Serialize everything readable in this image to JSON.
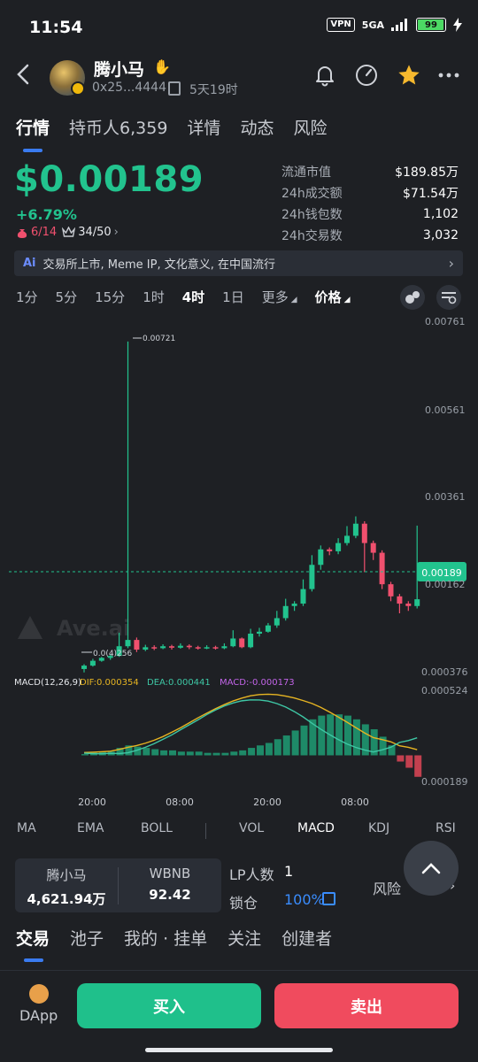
{
  "status_bar": {
    "time": "11:54",
    "vpn": "VPN",
    "network": "5GA",
    "battery": "99",
    "battery_level": 0.99
  },
  "header": {
    "token_name": "腾小马",
    "address": "0x25...4444",
    "age": "5天19时"
  },
  "tabs": [
    "行情",
    "持币人6,359",
    "详情",
    "动态",
    "风险"
  ],
  "price": {
    "value": "$0.00189",
    "change": "+6.79%",
    "badge_left": "6/14",
    "badge_right": "34/50"
  },
  "stats": [
    {
      "label": "流通市值",
      "value": "$189.85万"
    },
    {
      "label": "24h成交额",
      "value": "$71.54万"
    },
    {
      "label": "24h钱包数",
      "value": "1,102"
    },
    {
      "label": "24h交易数",
      "value": "3,032"
    }
  ],
  "ai_banner": {
    "icon": "Ai",
    "text": "交易所上市, Meme IP, 文化意义, 在中国流行"
  },
  "timeframes": [
    "1分",
    "5分",
    "15分",
    "1时",
    "4时",
    "1日",
    "更多",
    "价格"
  ],
  "active_timeframe": "4时",
  "chart": {
    "y_labels": [
      "0.00761",
      "0.00561",
      "0.00361",
      "0.00162",
      "0.000376"
    ],
    "current_price_label": "0.00189",
    "high_annotation": "0.00721",
    "low_annotation": "0.0(4)256",
    "watermark": "Ave.ai",
    "macd_header": {
      "params": "MACD(12,26,9)",
      "dif": "DIF:0.000354",
      "dea": "DEA:0.000441",
      "macd": "MACD:-0.000173"
    },
    "macd_y_labels": [
      "0.000524",
      "0.000189"
    ],
    "x_labels": [
      "20:00",
      "08:00",
      "20:00",
      "08:00"
    ],
    "colors": {
      "up": "#22c38e",
      "down": "#f0506e",
      "dif": "#e6b422",
      "dea": "#3ec7a5",
      "macd": "#c264e8"
    }
  },
  "indicator_tabs": {
    "main": [
      "MA",
      "EMA",
      "BOLL"
    ],
    "sub": [
      "VOL",
      "MACD",
      "KDJ",
      "RSI"
    ],
    "active": "MACD"
  },
  "pair": {
    "base_name": "腾小马",
    "base_amount": "4,621.94万",
    "quote_name": "WBNB",
    "quote_amount": "92.42"
  },
  "lp": {
    "count_label": "LP人数",
    "count": "1",
    "lock_label": "锁仓",
    "lock_value": "100%",
    "risk_label": "风险"
  },
  "trade_tabs": [
    "交易",
    "池子",
    "我的 · 挂单",
    "关注",
    "创建者"
  ],
  "bottom": {
    "dapp_label": "DApp",
    "buy_label": "买入",
    "sell_label": "卖出"
  },
  "chart_data": {
    "type": "candlestick",
    "y_range": [
      0.000376,
      0.00761
    ],
    "candles": [
      {
        "o": 0.00045,
        "c": 0.00052,
        "h": 0.00055,
        "l": 0.00038
      },
      {
        "o": 0.00052,
        "c": 0.00062,
        "h": 0.00066,
        "l": 0.0005
      },
      {
        "o": 0.00062,
        "c": 0.00068,
        "h": 0.0007,
        "l": 0.0006
      },
      {
        "o": 0.00068,
        "c": 0.00072,
        "h": 0.00075,
        "l": 0.00064
      },
      {
        "o": 0.00072,
        "c": 0.00092,
        "h": 0.0012,
        "l": 0.0007
      },
      {
        "o": 0.00092,
        "c": 0.00105,
        "h": 0.00721,
        "l": 0.00088
      },
      {
        "o": 0.00105,
        "c": 0.00085,
        "h": 0.0011,
        "l": 0.0008
      },
      {
        "o": 0.00085,
        "c": 0.0009,
        "h": 0.00095,
        "l": 0.00082
      },
      {
        "o": 0.0009,
        "c": 0.00088,
        "h": 0.00094,
        "l": 0.00084
      },
      {
        "o": 0.00088,
        "c": 0.00092,
        "h": 0.00096,
        "l": 0.00086
      },
      {
        "o": 0.00092,
        "c": 0.00089,
        "h": 0.00095,
        "l": 0.00085
      },
      {
        "o": 0.00089,
        "c": 0.00093,
        "h": 0.00098,
        "l": 0.00087
      },
      {
        "o": 0.00093,
        "c": 0.0009,
        "h": 0.00096,
        "l": 0.00086
      },
      {
        "o": 0.0009,
        "c": 0.00088,
        "h": 0.00093,
        "l": 0.00085
      },
      {
        "o": 0.00088,
        "c": 0.0009,
        "h": 0.00094,
        "l": 0.00086
      },
      {
        "o": 0.0009,
        "c": 0.00088,
        "h": 0.00093,
        "l": 0.00085
      },
      {
        "o": 0.00088,
        "c": 0.00092,
        "h": 0.00098,
        "l": 0.00086
      },
      {
        "o": 0.00092,
        "c": 0.00108,
        "h": 0.00125,
        "l": 0.0009
      },
      {
        "o": 0.00108,
        "c": 0.0009,
        "h": 0.0011,
        "l": 0.00088
      },
      {
        "o": 0.0009,
        "c": 0.00118,
        "h": 0.00128,
        "l": 0.00088
      },
      {
        "o": 0.00118,
        "c": 0.00122,
        "h": 0.0013,
        "l": 0.00112
      },
      {
        "o": 0.00122,
        "c": 0.00135,
        "h": 0.0014,
        "l": 0.0012
      },
      {
        "o": 0.00135,
        "c": 0.0015,
        "h": 0.00165,
        "l": 0.0013
      },
      {
        "o": 0.0015,
        "c": 0.00175,
        "h": 0.0019,
        "l": 0.00145
      },
      {
        "o": 0.00175,
        "c": 0.0018,
        "h": 0.00185,
        "l": 0.00165
      },
      {
        "o": 0.0018,
        "c": 0.0021,
        "h": 0.0023,
        "l": 0.00175
      },
      {
        "o": 0.0021,
        "c": 0.0026,
        "h": 0.0028,
        "l": 0.00205
      },
      {
        "o": 0.0026,
        "c": 0.00292,
        "h": 0.003,
        "l": 0.0025
      },
      {
        "o": 0.00292,
        "c": 0.00288,
        "h": 0.00296,
        "l": 0.0028
      },
      {
        "o": 0.00288,
        "c": 0.00305,
        "h": 0.00315,
        "l": 0.00282
      },
      {
        "o": 0.00305,
        "c": 0.0032,
        "h": 0.0034,
        "l": 0.003
      },
      {
        "o": 0.0032,
        "c": 0.00345,
        "h": 0.0036,
        "l": 0.00315
      },
      {
        "o": 0.00345,
        "c": 0.00305,
        "h": 0.0035,
        "l": 0.00245
      },
      {
        "o": 0.00305,
        "c": 0.00285,
        "h": 0.0031,
        "l": 0.0027
      },
      {
        "o": 0.00285,
        "c": 0.0022,
        "h": 0.0029,
        "l": 0.0021
      },
      {
        "o": 0.0022,
        "c": 0.00195,
        "h": 0.00225,
        "l": 0.00185
      },
      {
        "o": 0.00195,
        "c": 0.0018,
        "h": 0.002,
        "l": 0.0016
      },
      {
        "o": 0.0018,
        "c": 0.00175,
        "h": 0.00185,
        "l": 0.00165
      },
      {
        "o": 0.00175,
        "c": 0.00189,
        "h": 0.00341,
        "l": 0.0017
      }
    ],
    "macd_values": [
      1e-05,
      2e-05,
      3e-05,
      3e-05,
      6e-05,
      8e-05,
      7e-05,
      6e-05,
      5e-05,
      4e-05,
      4e-05,
      3e-05,
      3e-05,
      3e-05,
      2e-05,
      2e-05,
      2e-05,
      3e-05,
      4e-05,
      6e-05,
      8e-05,
      0.0001,
      0.00013,
      0.00016,
      0.0002,
      0.00024,
      0.00029,
      0.00032,
      0.00033,
      0.00033,
      0.00032,
      0.00029,
      0.00025,
      0.00021,
      0.00015,
      8e-05,
      -5e-05,
      -0.0001,
      -0.000173
    ],
    "macd_range": [
      -0.000189,
      0.000524
    ]
  }
}
